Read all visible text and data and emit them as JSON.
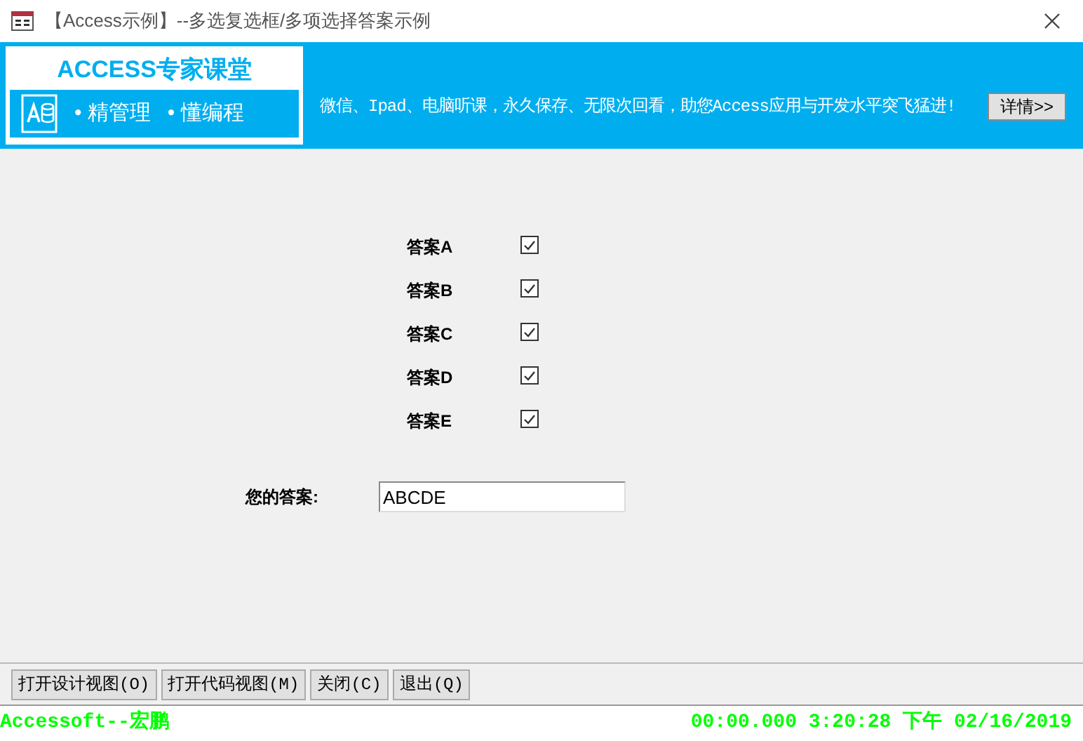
{
  "window": {
    "title": "【Access示例】--多选复选框/多项选择答案示例"
  },
  "banner": {
    "logo_title": "ACCESS专家课堂",
    "logo_tagline_1": "•  精管理",
    "logo_tagline_2": "•  懂编程",
    "slogan": "微信、Ipad、电脑听课，永久保存、无限次回看，助您Access应用与开发水平突飞猛进!",
    "details_button": "详情>>"
  },
  "options": [
    {
      "label": "答案A",
      "checked": true
    },
    {
      "label": "答案B",
      "checked": true
    },
    {
      "label": "答案C",
      "checked": true
    },
    {
      "label": "答案D",
      "checked": true
    },
    {
      "label": "答案E",
      "checked": true
    }
  ],
  "answer": {
    "label": "您的答案:",
    "value": "ABCDE"
  },
  "buttons": [
    "打开设计视图(O)",
    "打开代码视图(M)",
    "关闭(C)",
    "退出(Q)"
  ],
  "status_bar": {
    "left": "Accessoft--宏鹏",
    "right": "00:00.000 3:20:28 下午 02/16/2019"
  }
}
